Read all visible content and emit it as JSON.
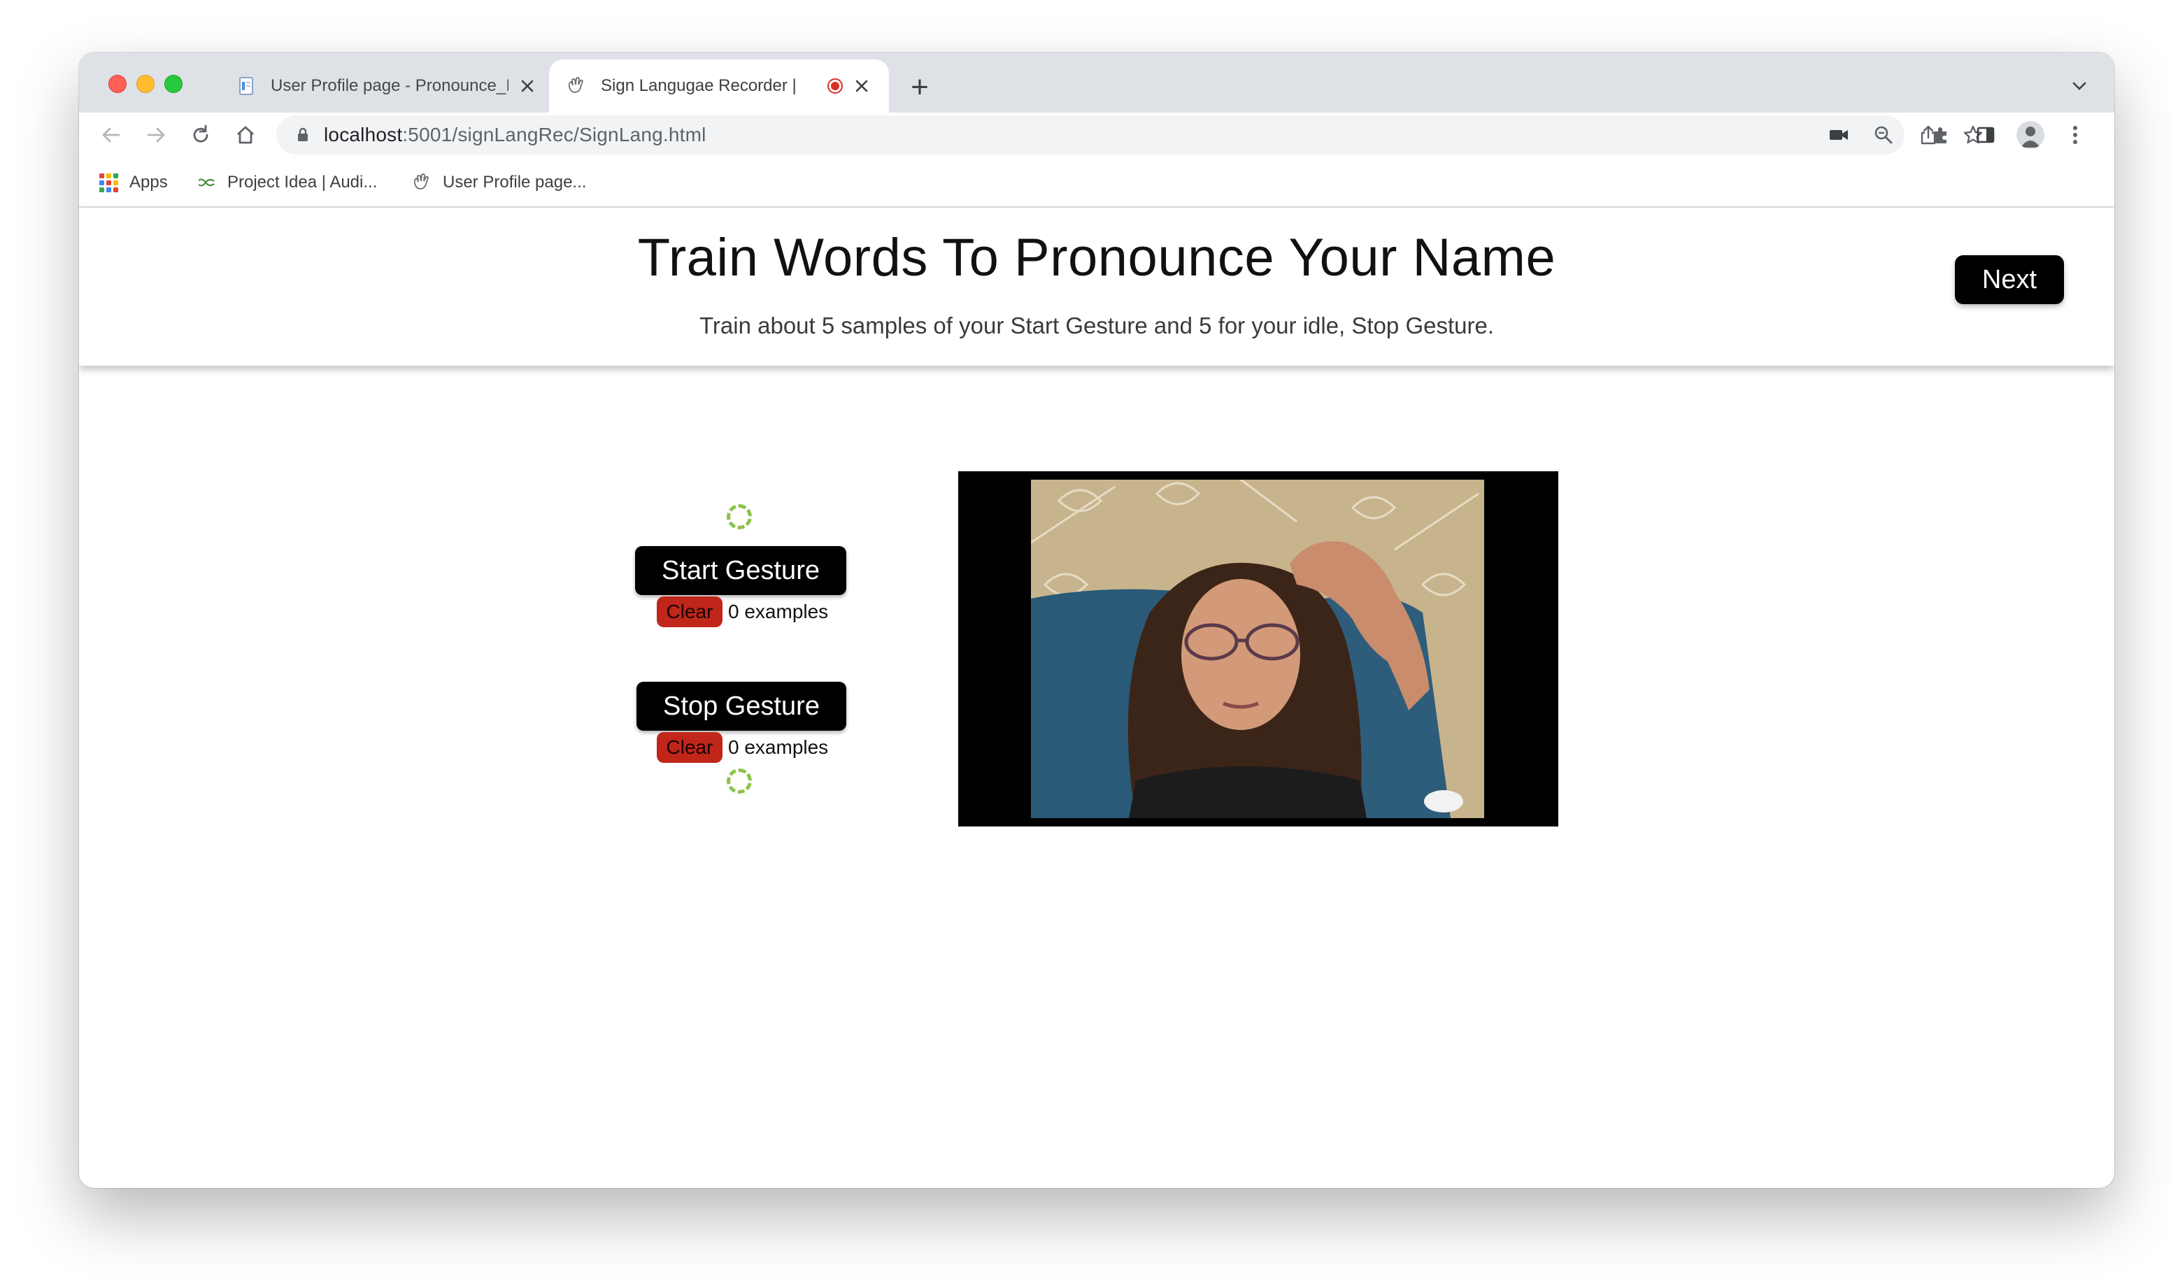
{
  "browser": {
    "tabs": [
      {
        "title": "User Profile page - Pronounce_I",
        "favicon": "document-icon",
        "active": false
      },
      {
        "title": "Sign Langugae Recorder | ",
        "favicon": "hand-sign-icon",
        "active": true,
        "recording": true
      }
    ],
    "new_tab_label": "+",
    "url_host": "localhost",
    "url_path": ":5001/signLangRec/SignLang.html",
    "bookmarks": [
      {
        "label": "Apps",
        "icon": "apps-grid-icon"
      },
      {
        "label": "Project Idea | Audi...",
        "icon": "link-icon"
      },
      {
        "label": "User Profile page...",
        "icon": "hand-sign-icon"
      }
    ]
  },
  "page": {
    "title": "Train Words To Pronounce Your Name",
    "subtitle": "Train about 5 samples of your Start Gesture and 5 for your idle, Stop Gesture.",
    "next_label": "Next",
    "gestures": [
      {
        "label": "Start Gesture",
        "clear_label": "Clear",
        "examples_text": "0 examples"
      },
      {
        "label": "Stop Gesture",
        "clear_label": "Clear",
        "examples_text": "0 examples"
      }
    ]
  },
  "colors": {
    "accent_button": "#000000",
    "clear_button": "#c0261a",
    "spinner": "#8bc34a",
    "recording_indicator": "#d93025"
  }
}
